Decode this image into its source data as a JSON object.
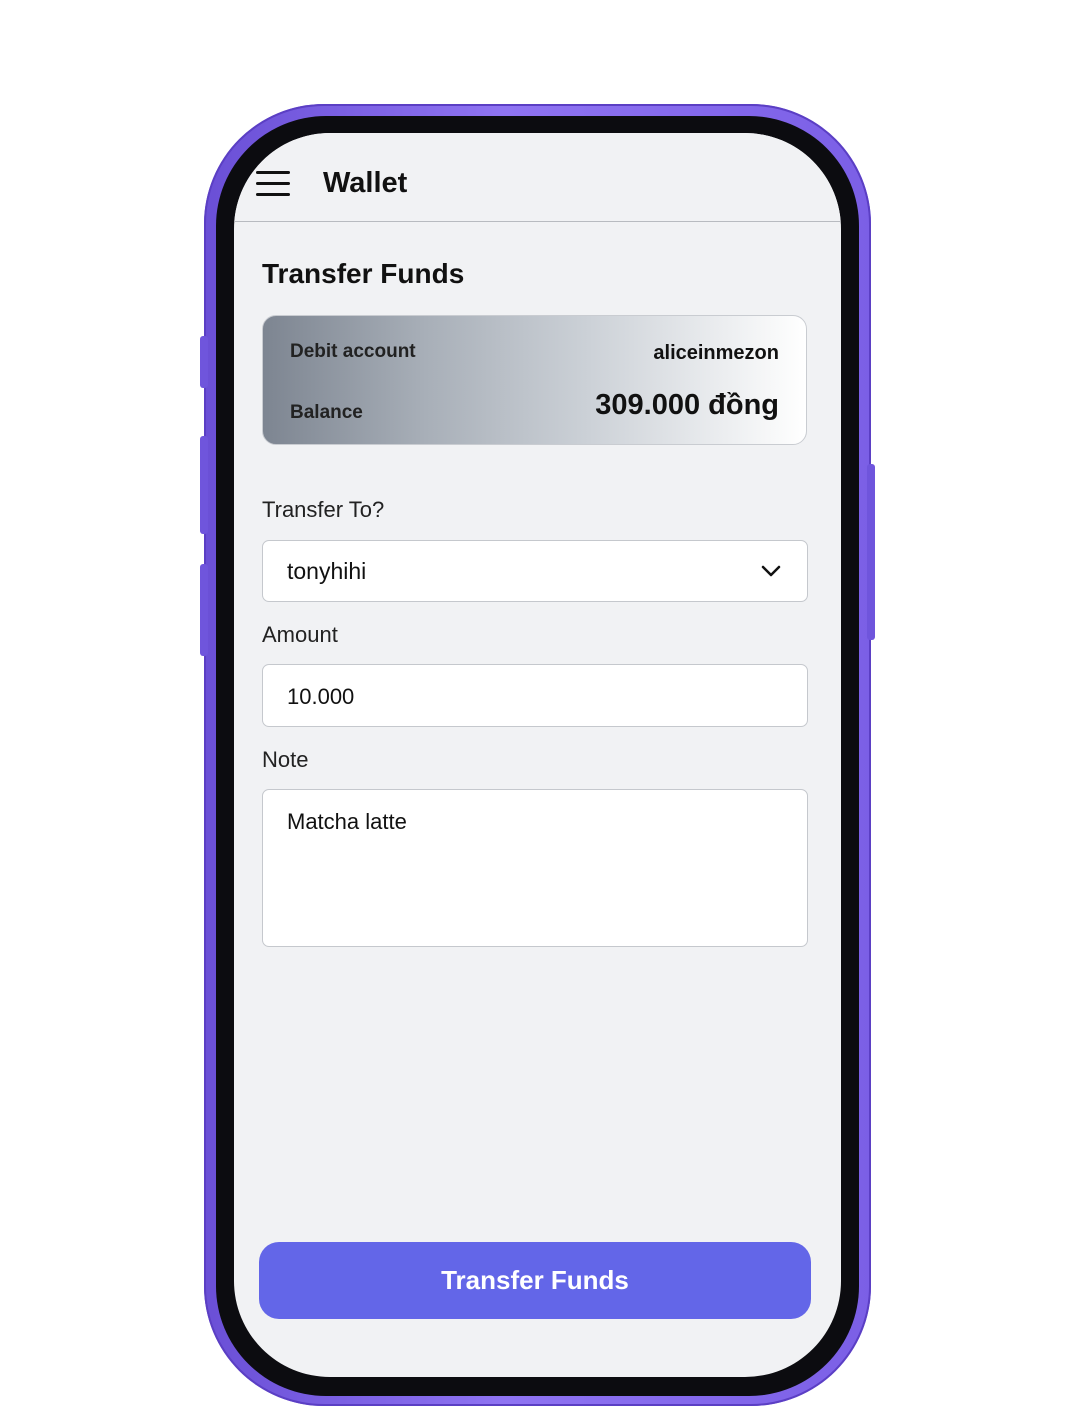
{
  "header": {
    "title": "Wallet",
    "menu_icon": "hamburger-menu-icon"
  },
  "main": {
    "section_title": "Transfer Funds",
    "account_card": {
      "debit_account_label": "Debit account",
      "debit_account_value": "aliceinmezon",
      "balance_label": "Balance",
      "balance_value": "309.000 đồng"
    },
    "transfer_to": {
      "label": "Transfer To?",
      "selected_value": "tonyhihi",
      "dropdown_icon": "chevron-down-icon"
    },
    "amount": {
      "label": "Amount",
      "value": "10.000"
    },
    "note": {
      "label": "Note",
      "value": "Matcha latte"
    },
    "submit_label": "Transfer Funds"
  },
  "colors": {
    "phone_frame": "#7b5fe6",
    "screen_background": "#f1f2f4",
    "primary_button": "#6366e8",
    "button_text": "#ffffff"
  }
}
